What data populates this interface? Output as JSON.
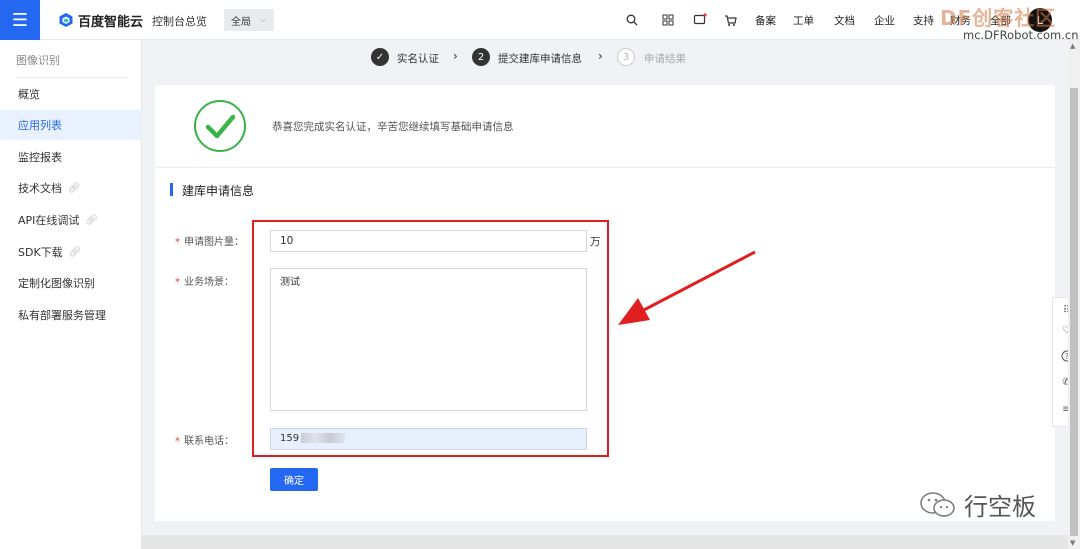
{
  "header": {
    "menu_icon": "menu-icon",
    "brand": "百度智能云",
    "console_link": "控制台总览",
    "region": "全局",
    "links": [
      "备案",
      "工单",
      "文档",
      "企业",
      "支持",
      "财务",
      "全部"
    ],
    "avatar_letter": "L",
    "brand_color": "#2468f2"
  },
  "watermark": {
    "top_logo": "DF创客社区",
    "top_url": "mc.DFRobot.com.cn",
    "bottom_text": "行空板"
  },
  "sidebar": {
    "title": "图像识别",
    "items": [
      {
        "label": "概览",
        "active": false,
        "external": false
      },
      {
        "label": "应用列表",
        "active": true,
        "external": false
      },
      {
        "label": "监控报表",
        "active": false,
        "external": false
      },
      {
        "label": "技术文档",
        "active": false,
        "external": true
      },
      {
        "label": "API在线调试",
        "active": false,
        "external": true
      },
      {
        "label": "SDK下载",
        "active": false,
        "external": true
      },
      {
        "label": "定制化图像识别",
        "active": false,
        "external": false
      },
      {
        "label": "私有部署服务管理",
        "active": false,
        "external": false
      }
    ]
  },
  "steps": [
    {
      "num": "✓",
      "label": "实名认证",
      "state": "done"
    },
    {
      "num": "2",
      "label": "提交建库申请信息",
      "state": "current"
    },
    {
      "num": "3",
      "label": "申请结果",
      "state": "todo"
    }
  ],
  "main": {
    "success_message": "恭喜您完成实名认证，辛苦您继续填写基础申请信息",
    "section_title": "建库申请信息",
    "form": {
      "image_count_label": "申请图片量：",
      "image_count_value": "10",
      "image_count_unit": "万",
      "scenario_label": "业务场景：",
      "scenario_value": "测试",
      "phone_label": "联系电话：",
      "phone_value": "159",
      "confirm_label": "确定"
    }
  }
}
